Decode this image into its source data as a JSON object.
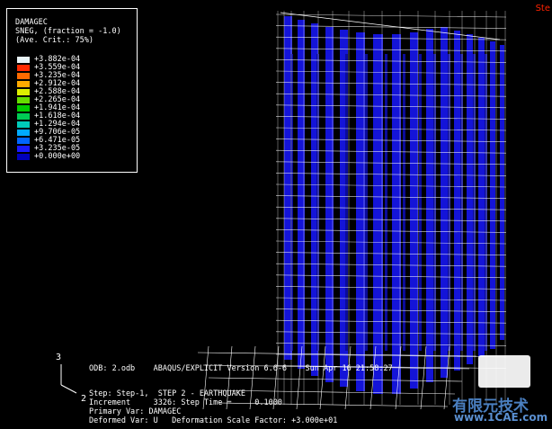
{
  "legend": {
    "title": "DAMAGEC",
    "subtitle": "SNEG, (fraction = -1.0)",
    "crit": "(Ave. Crit.: 75%)",
    "items": [
      {
        "label": "+3.882e-04",
        "color": "#e8f4f8"
      },
      {
        "label": "+3.559e-04",
        "color": "#ff2a00"
      },
      {
        "label": "+3.235e-04",
        "color": "#ff6a00"
      },
      {
        "label": "+2.912e-04",
        "color": "#ffaa00"
      },
      {
        "label": "+2.588e-04",
        "color": "#ddee00"
      },
      {
        "label": "+2.265e-04",
        "color": "#66dd00"
      },
      {
        "label": "+1.941e-04",
        "color": "#00cc00"
      },
      {
        "label": "+1.618e-04",
        "color": "#00cc55"
      },
      {
        "label": "+1.294e-04",
        "color": "#00ccbb"
      },
      {
        "label": "+9.706e-05",
        "color": "#00aaff"
      },
      {
        "label": "+6.471e-05",
        "color": "#0066ff"
      },
      {
        "label": "+3.235e-05",
        "color": "#1a1aff"
      },
      {
        "label": "+0.000e+00",
        "color": "#0000bb"
      }
    ]
  },
  "info": {
    "odb": "ODB: 2.odb    ABAQUS/EXPLICIT Version 6.6-6    Sun Apr 16 21:58:27",
    "step": "Step: Step-1,  STEP 2 - EARTHQUAKE",
    "increment": "Increment     3326: Step Time =     0.1000",
    "primary": "Primary Var: DAMAGEC",
    "deformed": "Deformed Var: U   Deformation Scale Factor: +3.000e+01"
  },
  "triad": {
    "axis_3": "3",
    "axis_2": "2"
  },
  "corner_text": "Ste",
  "watermark": {
    "line1": "有限元技术",
    "line2": "www.1CAE.com"
  },
  "colors": {
    "bar": "#1414d8",
    "frame": "#ffffff",
    "background": "#000000"
  }
}
